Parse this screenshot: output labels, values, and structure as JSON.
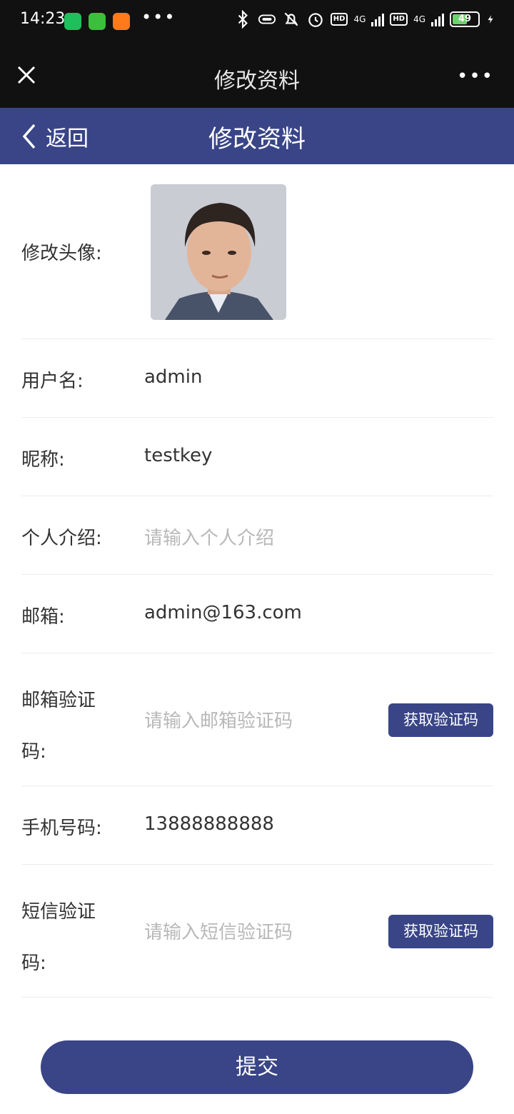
{
  "status_bar": {
    "time": "14:23",
    "network1": "4G",
    "network2": "4G",
    "hd_badge": "HD",
    "battery": "49"
  },
  "wechat_header": {
    "title": "修改资料",
    "close_icon": "close-icon",
    "more_icon": "more-icon"
  },
  "navbar": {
    "back_label": "返回",
    "title": "修改资料",
    "accent": "#394586"
  },
  "form": {
    "avatar_label": "修改头像:",
    "username_label": "用户名:",
    "username_value": "admin",
    "nickname_label": "昵称:",
    "nickname_value": "testkey",
    "bio_label": "个人介绍:",
    "bio_placeholder": "请输入个人介绍",
    "email_label": "邮箱:",
    "email_value": "admin@163.com",
    "email_code_label": "邮箱验证码:",
    "email_code_placeholder": "请输入邮箱验证码",
    "email_code_button": "获取验证码",
    "phone_label": "手机号码:",
    "phone_value": "13888888888",
    "sms_code_label": "短信验证码:",
    "sms_code_placeholder": "请输入短信验证码",
    "sms_code_button": "获取验证码"
  },
  "submit_label": "提交"
}
